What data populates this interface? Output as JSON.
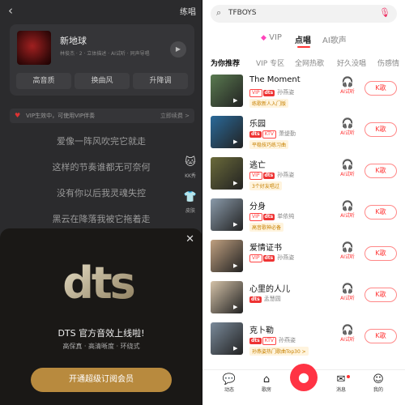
{
  "left": {
    "back_icon": "back-arrow-icon",
    "practice_label": "练唱",
    "song": {
      "title": "新地球",
      "subtitle": "林俊杰 · 2 · 立体描述 · AI试听 · 同声导唱",
      "play_icon": "play-icon"
    },
    "quality_buttons": [
      "高音质",
      "换曲风",
      "升降调"
    ],
    "vip_notice": "VIP生效中，可使用VIP伴奏",
    "vip_link": "立即续费 >",
    "lyrics": [
      "爱像一阵风吹完它就走",
      "这样的节奏谁都无可奈何",
      "没有你以后我灵魂失控",
      "黑云在降落我被它拖着走"
    ],
    "side_items": [
      {
        "icon": "cat-icon",
        "label": "KK秀"
      },
      {
        "icon": "shirt-icon",
        "label": "皮肤"
      }
    ],
    "popup": {
      "logo_text": "dts",
      "title": "DTS 官方音效上线啦!",
      "subtitle": "高保真 · 高清晰度 · 环绕式",
      "button": "开通超级订阅会员",
      "close_icon": "close-icon"
    }
  },
  "right": {
    "search": {
      "value": "TFBOYS",
      "search_icon": "search-icon",
      "mic_icon": "mic-icon"
    },
    "main_tabs": [
      {
        "label": "VIP",
        "active": false
      },
      {
        "label": "点唱",
        "active": true
      },
      {
        "label": "AI歌声",
        "active": false
      }
    ],
    "sub_tabs": [
      {
        "label": "为你推荐",
        "active": true
      },
      {
        "label": "VIP 专区",
        "active": false
      },
      {
        "label": "全网热歌",
        "active": false
      },
      {
        "label": "好久没唱",
        "active": false
      },
      {
        "label": "伤感情",
        "active": false
      }
    ],
    "songs": [
      {
        "title": "The Moment",
        "tags": [
          "VIP",
          "dts"
        ],
        "artist": "孙燕姿",
        "badge": "练歌新人入门版",
        "thumb_color": "#5a7a50"
      },
      {
        "title": "乐园",
        "tags": [
          "dts",
          "KTV"
        ],
        "artist": "萧缇勤",
        "badge": "平稳技巧练习曲",
        "thumb_color": "#2a6a9a"
      },
      {
        "title": "逃亡",
        "tags": [
          "VIP",
          "dts"
        ],
        "artist": "孙燕姿",
        "badge": "3个好友唱过",
        "thumb_color": "#6a6a3a"
      },
      {
        "title": "分身",
        "tags": [
          "VIP",
          "dts"
        ],
        "artist": "单依纯",
        "badge": "高音歌神必备",
        "thumb_color": "#8a9aaa"
      },
      {
        "title": "爱情证书",
        "tags": [
          "VIP",
          "dts"
        ],
        "artist": "孙燕姿",
        "badge": "",
        "thumb_color": "#c0a080"
      },
      {
        "title": "心里的人儿",
        "tags": [
          "dts"
        ],
        "artist": "孟慧圆",
        "badge": "",
        "thumb_color": "#d4c2a8"
      },
      {
        "title": "克卜勒",
        "tags": [
          "dts",
          "KTV"
        ],
        "artist": "孙燕姿",
        "badge": "孙燕姿热门歌曲Top30 >",
        "thumb_color": "#7a8a9a"
      }
    ],
    "ai_label": "AI试听",
    "k_label": "K歌",
    "bottom_nav": [
      {
        "icon": "chat-icon",
        "label": "动态"
      },
      {
        "icon": "song-room-icon",
        "label": "歌房"
      },
      {
        "icon": "mic-center-icon",
        "label": ""
      },
      {
        "icon": "message-icon",
        "label": "消息"
      },
      {
        "icon": "profile-icon",
        "label": "我的"
      }
    ]
  }
}
